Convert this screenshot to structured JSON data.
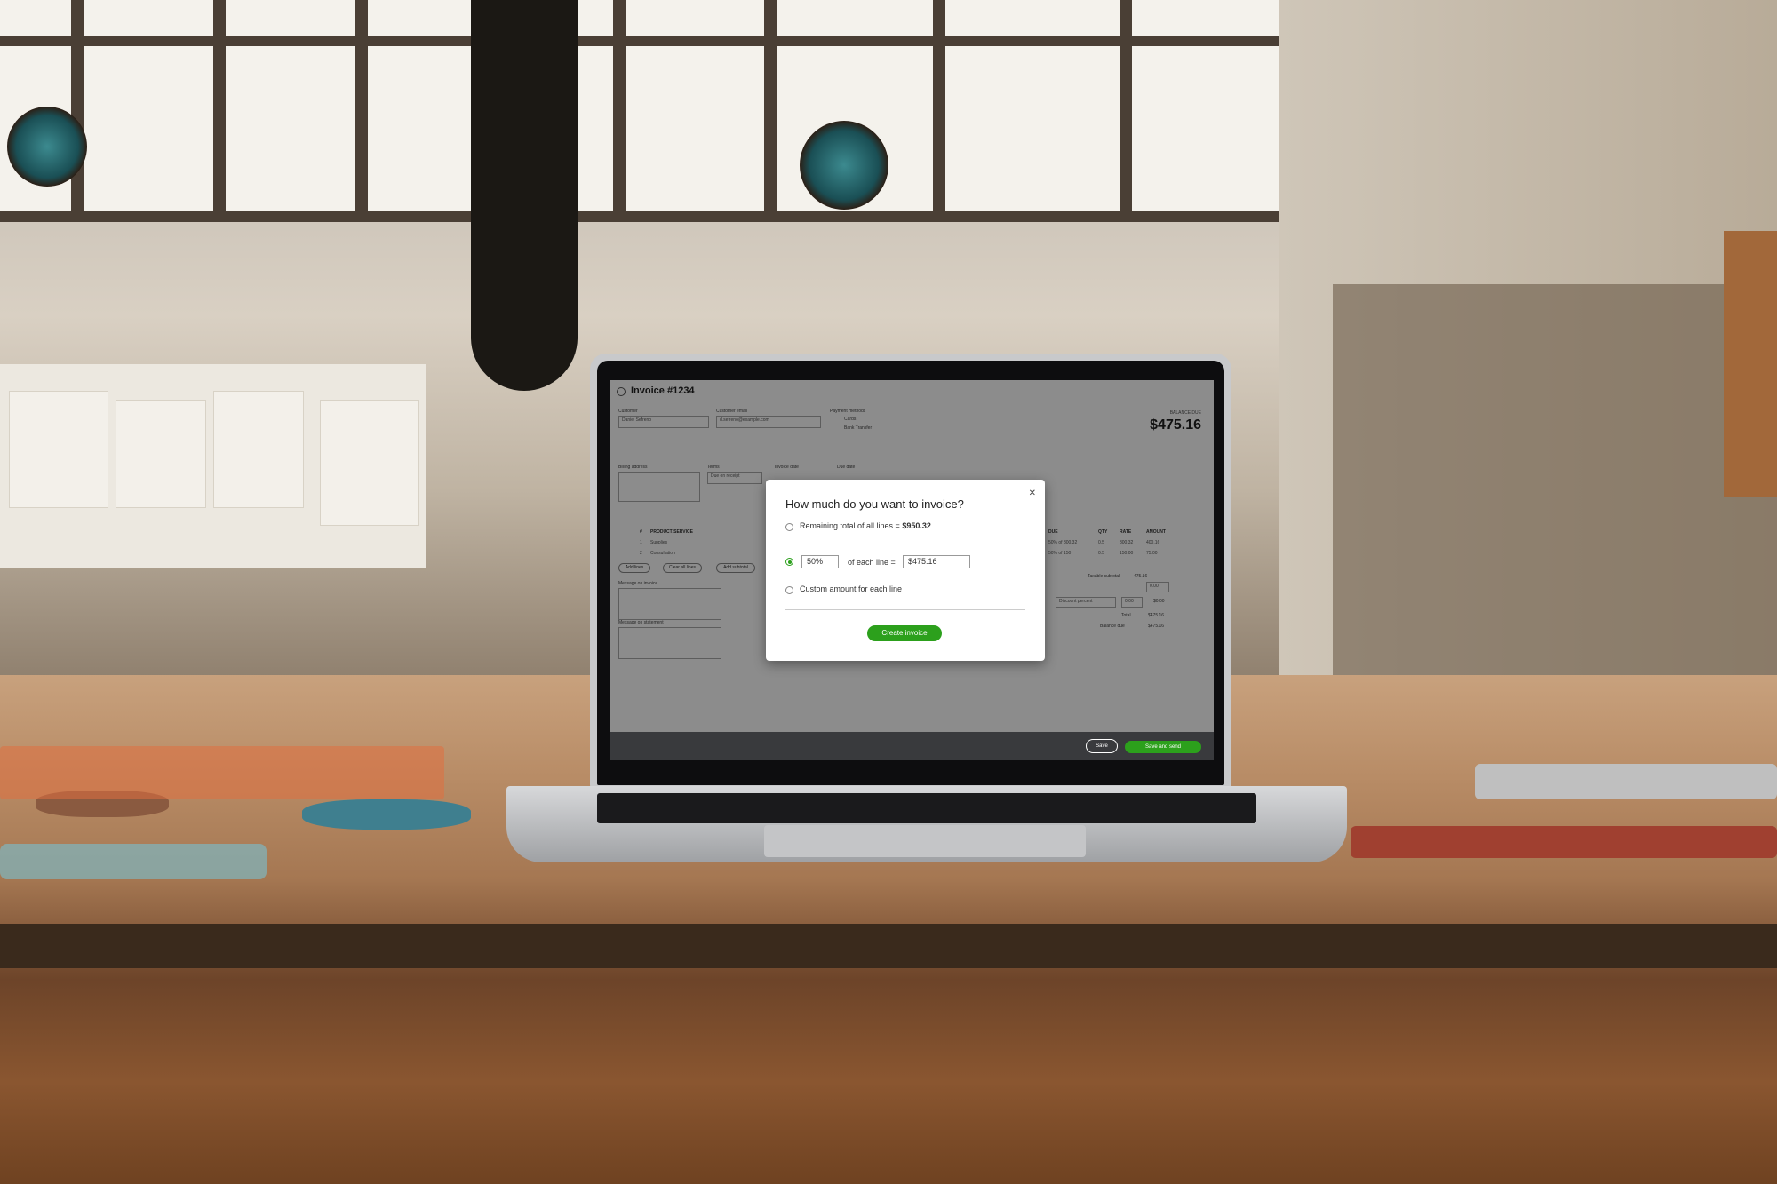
{
  "invoice": {
    "title": "Invoice #1234",
    "customer_label": "Customer",
    "customer_value": "Daniel Sefreno",
    "email_label": "Customer email",
    "email_value": "d.sefreno@example.com",
    "payment_label": "Payment methods",
    "cards_label": "Cards",
    "bank_label": "Bank Transfer",
    "balance_label": "BALANCE DUE",
    "balance_amount": "$475.16",
    "billing_label": "Billing address",
    "terms_label": "Terms",
    "terms_value": "Due on receipt",
    "invoice_date_label": "Invoice date",
    "due_date_label": "Due date",
    "table_headers": [
      "#",
      "PRODUCT/SERVICE",
      "DUE",
      "QTY",
      "RATE",
      "AMOUNT"
    ],
    "rows": [
      {
        "num": "1",
        "product": "Supplies",
        "due": "50% of 800.32",
        "qty": "0.5",
        "rate": "800.32",
        "amount": "400.16"
      },
      {
        "num": "2",
        "product": "Consultation",
        "due": "50% of 150",
        "qty": "0.5",
        "rate": "150.00",
        "amount": "75.00"
      }
    ],
    "add_lines": "Add lines",
    "clear_lines": "Clear all lines",
    "add_subtotal": "Add subtotal",
    "message_invoice_label": "Message on invoice",
    "message_statement_label": "Message on statement",
    "taxable_subtotal_label": "Taxable subtotal",
    "taxable_subtotal_value": "475.16",
    "tax_value": "0.00",
    "discount_label": "Discount percent",
    "discount_input": "0.00",
    "discount_value": "$0.00",
    "total_label": "Total",
    "total_value": "$475.16",
    "balance_due_label": "Balance due",
    "balance_due_value": "$475.16",
    "save_label": "Save",
    "save_send_label": "Save and send"
  },
  "modal": {
    "title": "How much do you want to invoice?",
    "close_icon": "close-icon",
    "option1_text": "Remaining total of all lines = ",
    "option1_amount": "$950.32",
    "option2_percent": "50%",
    "option2_text": "of each line =",
    "option2_amount": "$475.16",
    "option3_text": "Custom amount for each line",
    "selected_option": 2,
    "create_label": "Create invoice"
  },
  "colors": {
    "accent": "#2ca01c",
    "footer": "#393a3d"
  }
}
